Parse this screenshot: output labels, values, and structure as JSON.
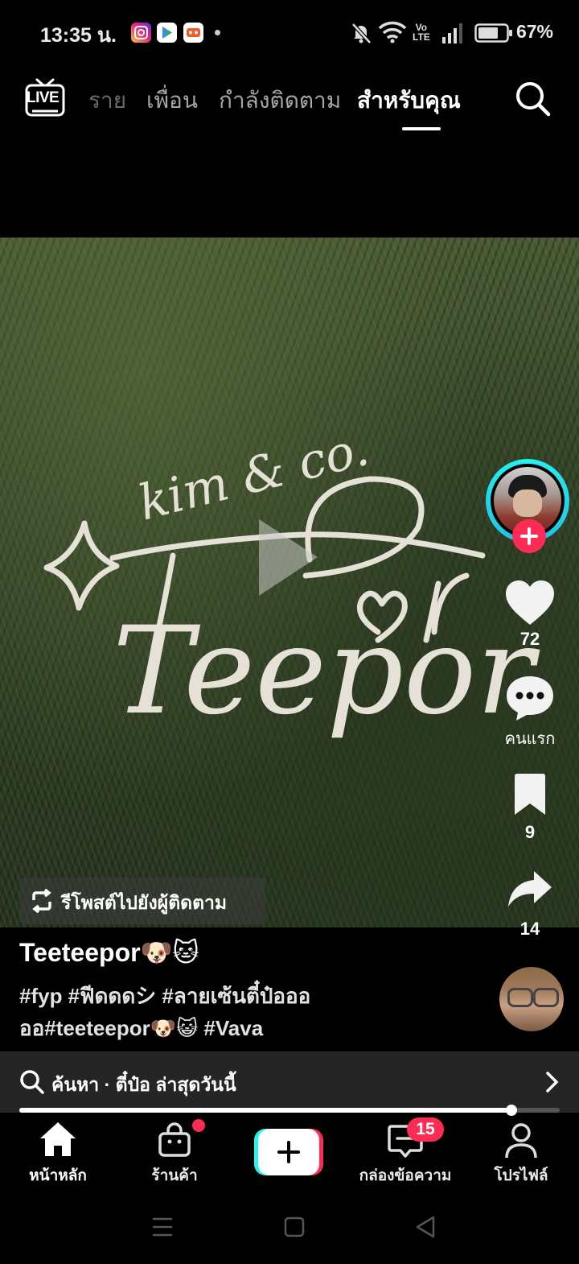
{
  "status_bar": {
    "time": "13:35 น.",
    "battery": "67%",
    "app_icons": [
      "instagram-icon",
      "google-play-icon",
      "game-app-icon"
    ],
    "indicators": [
      "mute-bell-icon",
      "wifi-icon",
      "volte-icon",
      "signal-icon",
      "battery-icon"
    ]
  },
  "top_nav": {
    "tabs": [
      {
        "label": "ราย"
      },
      {
        "label": "เพื่อน"
      },
      {
        "label": "กำลังติดตาม"
      },
      {
        "label": "สำหรับคุณ"
      }
    ],
    "active_tab": "สำหรับคุณ",
    "live_label": "LIVE"
  },
  "video": {
    "overlay_text": {
      "script": "Teepor",
      "subline": "kim & co."
    },
    "repost_label": "รีโพสต์ไปยังผู้ติดตาม"
  },
  "actions": {
    "likes": "72",
    "comments": "คนแรก",
    "bookmarks": "9",
    "shares": "14"
  },
  "caption": {
    "username": "Teeteepor🐶🐱",
    "text_line1": "#fyp #ฟีดดดシ #ลายเซ้นตี๋ป๋อออ",
    "text_line2": "ออ#teeteepor🐶😺 #Vava"
  },
  "search_bar": {
    "text": "ค้นหา · ตี๋ป๋อ ล่าสุดวันนี้"
  },
  "progress": {
    "value": 0.91
  },
  "bottom_nav": {
    "items": [
      {
        "label": "หน้าหลัก",
        "icon": "home-icon"
      },
      {
        "label": "ร้านค้า",
        "icon": "shop-bag-icon"
      },
      {
        "label": "",
        "icon": "create-plus-icon"
      },
      {
        "label": "กล่องข้อความ",
        "icon": "inbox-icon"
      },
      {
        "label": "โปรไฟล์",
        "icon": "profile-icon"
      }
    ],
    "inbox_badge": "15"
  },
  "colors": {
    "accent": "#fe2c55",
    "cyan": "#25f4ee",
    "background": "#000000"
  }
}
